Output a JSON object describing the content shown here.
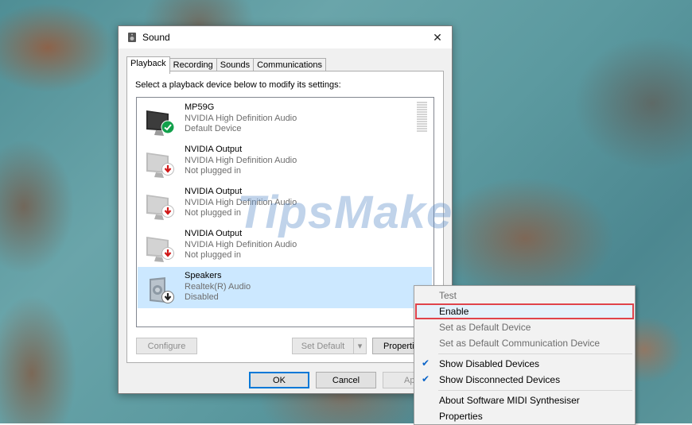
{
  "window": {
    "title": "Sound",
    "close_glyph": "✕"
  },
  "tabs": [
    {
      "label": "Playback",
      "active": true
    },
    {
      "label": "Recording"
    },
    {
      "label": "Sounds"
    },
    {
      "label": "Communications"
    }
  ],
  "instruction": "Select a playback device below to modify its settings:",
  "devices": [
    {
      "name": "MP59G",
      "driver": "NVIDIA High Definition Audio",
      "status": "Default Device",
      "icon": "monitor-icon",
      "badge": "check-badge-icon"
    },
    {
      "name": "NVIDIA Output",
      "driver": "NVIDIA High Definition Audio",
      "status": "Not plugged in",
      "icon": "monitor-icon",
      "badge": "unplugged-badge-icon"
    },
    {
      "name": "NVIDIA Output",
      "driver": "NVIDIA High Definition Audio",
      "status": "Not plugged in",
      "icon": "monitor-icon",
      "badge": "unplugged-badge-icon"
    },
    {
      "name": "NVIDIA Output",
      "driver": "NVIDIA High Definition Audio",
      "status": "Not plugged in",
      "icon": "monitor-icon",
      "badge": "unplugged-badge-icon"
    },
    {
      "name": "Speakers",
      "driver": "Realtek(R) Audio",
      "status": "Disabled",
      "icon": "speaker-icon",
      "badge": "disabled-badge-icon",
      "selected": true
    }
  ],
  "buttons": {
    "configure": "Configure",
    "set_default": "Set Default",
    "properties": "Properti",
    "ok": "OK",
    "cancel": "Cancel",
    "apply": "Ap"
  },
  "context_menu": {
    "items": [
      {
        "label": "Test",
        "disabled": true
      },
      {
        "label": "Enable",
        "highlighted": true
      },
      {
        "label": "Set as Default Device",
        "disabled": true
      },
      {
        "label": "Set as Default Communication Device",
        "disabled": true
      },
      {
        "label": "Show Disabled Devices",
        "checked": true
      },
      {
        "label": "Show Disconnected Devices",
        "checked": true
      },
      {
        "label": "About Software MIDI Synthesiser"
      },
      {
        "label": "Properties"
      }
    ],
    "check_glyph": "✔"
  },
  "watermark": "TipsMake",
  "colors": {
    "selection": "#cce8ff",
    "highlight_border": "#e0434b",
    "accent": "#0078d7"
  }
}
